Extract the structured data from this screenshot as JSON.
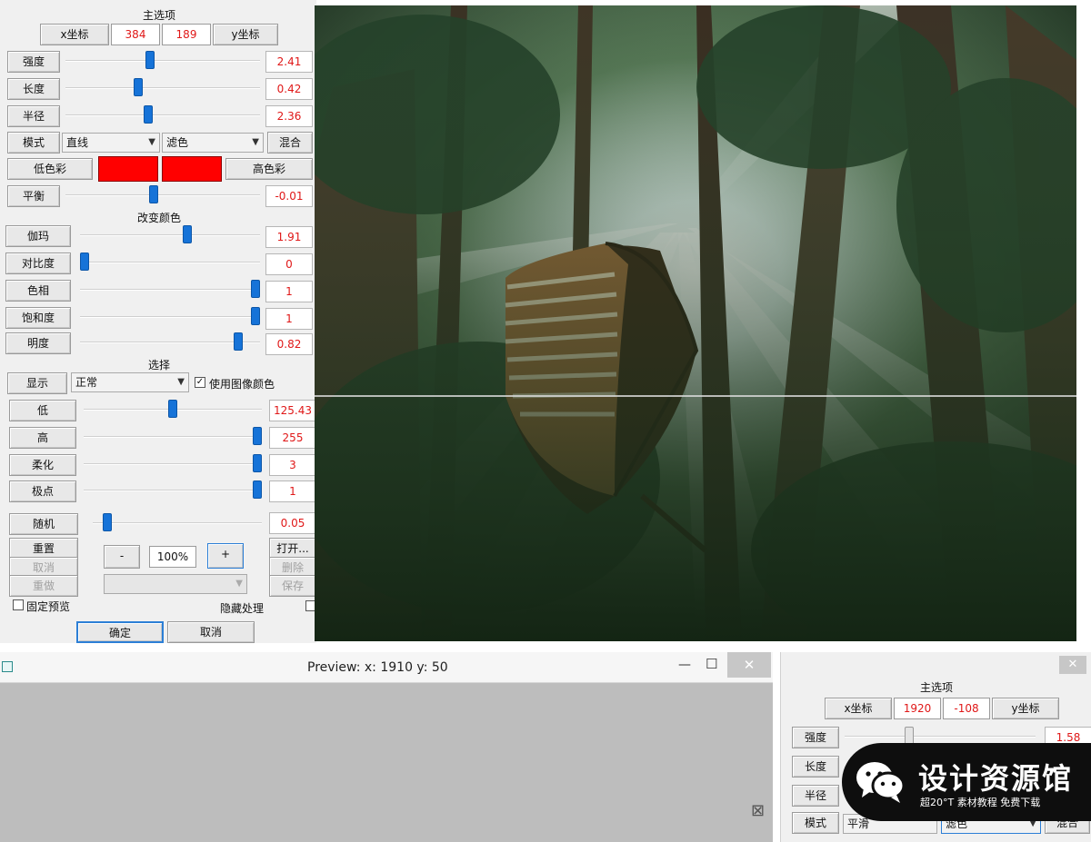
{
  "left_panel": {
    "main_options_title": "主选项",
    "x_coord_tab": "x坐标",
    "y_coord_tab": "y坐标",
    "x_value": "384",
    "y_value": "189",
    "rows": [
      {
        "label": "强度",
        "value": "2.41",
        "level": 0.43
      },
      {
        "label": "长度",
        "value": "0.42",
        "level": 0.37
      },
      {
        "label": "半径",
        "value": "2.36",
        "level": 0.42
      }
    ],
    "mode_label": "模式",
    "mode_select": "直线",
    "blend_select": "滤色",
    "mix_button": "混合",
    "low_color_button": "低色彩",
    "high_color_button": "高色彩",
    "balance": {
      "label": "平衡",
      "value": "-0.01",
      "level": 0.45
    },
    "change_color_title": "改变颜色",
    "color_rows": [
      {
        "label": "伽玛",
        "value": "1.91",
        "level": 0.6
      },
      {
        "label": "对比度",
        "value": "0",
        "level": 0.0
      },
      {
        "label": "色相",
        "value": "1",
        "level": 1.0
      },
      {
        "label": "饱和度",
        "value": "1",
        "level": 1.0
      },
      {
        "label": "明度",
        "value": "0.82",
        "level": 0.9
      }
    ],
    "select_title": "选择",
    "display_button": "显示",
    "display_select": "正常",
    "use_image_color_label": "使用图像颜色",
    "use_image_color_mark": "✓",
    "select_rows": [
      {
        "label": "低",
        "value": "125.43",
        "level": 0.5
      },
      {
        "label": "高",
        "value": "255",
        "level": 1.0
      },
      {
        "label": "柔化",
        "value": "3",
        "level": 1.0
      },
      {
        "label": "极点",
        "value": "1",
        "level": 1.0
      }
    ],
    "random": {
      "label": "随机",
      "value": "0.05",
      "level": 0.05
    },
    "reset_button": "重置",
    "undo_button": "取消",
    "redo_button": "重做",
    "minus_button": "-",
    "zoom_value": "100%",
    "plus_button": "+",
    "open_button": "打开...",
    "delete_button": "删除",
    "save_button": "保存",
    "fixed_preview_label": "固定预览",
    "hide_process_label": "隐藏处理",
    "ok_button": "确定",
    "cancel_button": "取消"
  },
  "preview_window": {
    "title": "Preview:  x: 1910 y: 50",
    "minimize_glyph": "—",
    "maximize_glyph": "☐",
    "close_glyph": "✕",
    "resize_glyph": "⊠"
  },
  "right_panel": {
    "main_options_title": "主选项",
    "x_coord_tab": "x坐标",
    "y_coord_tab": "y坐标",
    "x_value": "1920",
    "y_value": "-108",
    "close_glyph": "✕",
    "rows": [
      {
        "label": "强度",
        "value": "1.58"
      },
      {
        "label": "长度",
        "value": ""
      },
      {
        "label": "半径",
        "value": ""
      }
    ],
    "mode_label": "模式",
    "mode_select": "平滑",
    "blend_select": "滤色",
    "mix_button": "混合"
  },
  "watermark": {
    "title": "设计资源馆",
    "subtitle": "超20°T 素材教程 免费下载"
  },
  "colors": {
    "accent_blue": "#1673d8",
    "value_red": "#e01818",
    "swatch_red": "#ff0000",
    "panel_bg": "#f0f0f0"
  }
}
